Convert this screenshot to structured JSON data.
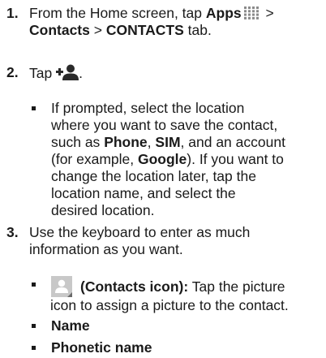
{
  "steps": [
    {
      "number": "1.",
      "lines": [
        {
          "pre": "From the Home screen, tap ",
          "bold": "Apps",
          "post": " >"
        },
        {
          "bold1": "Contacts",
          "mid": " > ",
          "bold2": "CONTACTS",
          "post": " tab."
        }
      ],
      "icons": [
        "apps-grid-icon"
      ]
    },
    {
      "number": "2.",
      "text": "Tap",
      "end": ".",
      "icons": [
        "add-contact-icon"
      ]
    },
    {
      "bullet": {
        "l1": "If prompted, select the location",
        "l2": "where you want to save the contact,",
        "l3_pre": "such as ",
        "l3_b1": "Phone",
        "l3_m1": ", ",
        "l3_b2": "SIM",
        "l3_post": ", and an account",
        "l4_pre": "(for example, ",
        "l4_b": "Google",
        "l4_post": "). If you want to",
        "l5": "change the location later, tap the",
        "l6": "location name, and select the",
        "l7": "desired location."
      }
    },
    {
      "number": "3.",
      "l1": "Use the keyboard to enter as much",
      "l2": "information as you want."
    }
  ],
  "fields": {
    "contacts_icon": {
      "bold": "(Contacts icon):",
      "rest": " Tap the picture",
      "l2": "icon to assign a picture to the contact.",
      "icon": "contact-picture-icon"
    },
    "name": "Name",
    "phonetic": "Phonetic name"
  },
  "colors": {
    "text": "#1a1a1a",
    "apps_icon": "#8a8a8a",
    "contacts_icon_bg": "#c8c8c8"
  }
}
